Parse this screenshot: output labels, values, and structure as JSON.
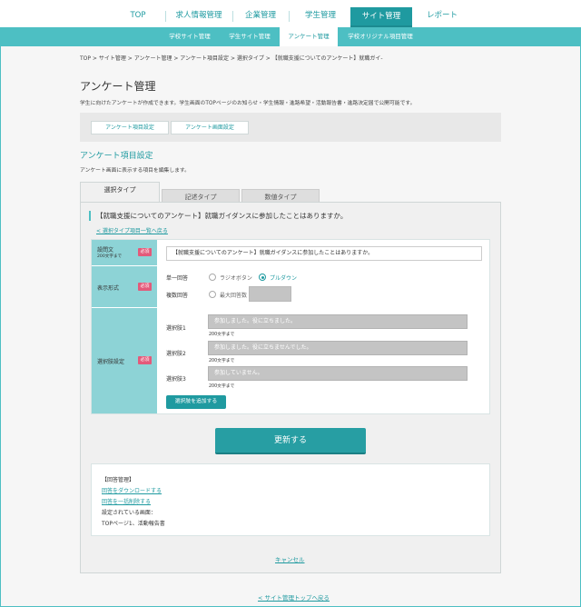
{
  "nav": {
    "items": [
      "TOP",
      "求人情報管理",
      "企業管理",
      "学生管理",
      "サイト管理",
      "レポート"
    ],
    "active": "サイト管理"
  },
  "subnav": {
    "items": [
      "学校サイト管理",
      "学生サイト管理",
      "アンケート管理",
      "学校オリジナル項目管理"
    ],
    "active": "アンケート管理"
  },
  "breadcrumb": "TOP > サイト管理 > アンケート管理 > アンケート項目設定 > 選択タイプ > 【就職支援についてのアンケート】就職ガイ-",
  "page": {
    "title": "アンケート管理",
    "description": "学生に向けたアンケートが作成できます。学生画面のTOPページのお知らせ・学生情報・進路希望・活動報告書・進路決定届で公開可能です。"
  },
  "mode_buttons": [
    "アンケート項目設定",
    "アンケート画面設定"
  ],
  "section": {
    "title": "アンケート項目設定",
    "description": "アンケート画面に表示する項目を編集します。"
  },
  "type_tabs": [
    "選択タイプ",
    "記述タイプ",
    "数値タイプ"
  ],
  "active_tab": "選択タイプ",
  "question": {
    "title": "【就職支援についてのアンケート】就職ガイダンスに参加したことはありますか。",
    "back_link": "< 選択タイプ項目一覧へ戻る"
  },
  "form": {
    "required_badge": "必須",
    "question_text": {
      "label": "設問文",
      "sublabel": "200文字まで",
      "value": "【就職支援についてのアンケート】就職ガイダンスに参加したことはありますか。"
    },
    "display_format": {
      "label": "表示形式",
      "single_label": "単一回答",
      "multi_label": "複数回答",
      "radio_button": "ラジオボタン",
      "pulldown": "プルダウン",
      "selected": "プルダウン",
      "max_answers_label": "最大回答数"
    },
    "choices": {
      "label": "選択肢設定",
      "items": [
        {
          "label": "選択肢1",
          "placeholder": "参加しました。役に立ちました。",
          "note": "200文字まで"
        },
        {
          "label": "選択肢2",
          "placeholder": "参加しました。役に立ちませんでした。",
          "note": "200文字まで"
        },
        {
          "label": "選択肢3",
          "placeholder": "参加していません。",
          "note": "200文字まで"
        }
      ],
      "add_button": "選択肢を追加する"
    }
  },
  "update_button": "更新する",
  "answers": {
    "heading": "【回答管理】",
    "download_link": "回答をダウンロードする",
    "delete_link": "回答を一括削除する",
    "screens_label": "設定されている画面：",
    "screens": "TOPページ1、活動報告書"
  },
  "cancel_link": "キャンセル",
  "footer_link": "< サイト管理トップへ戻る",
  "colors": {
    "accent": "#1f9aa0",
    "subnav": "#4dbfc3",
    "label_bg": "#8dd3d6",
    "required": "#e35a7a"
  }
}
